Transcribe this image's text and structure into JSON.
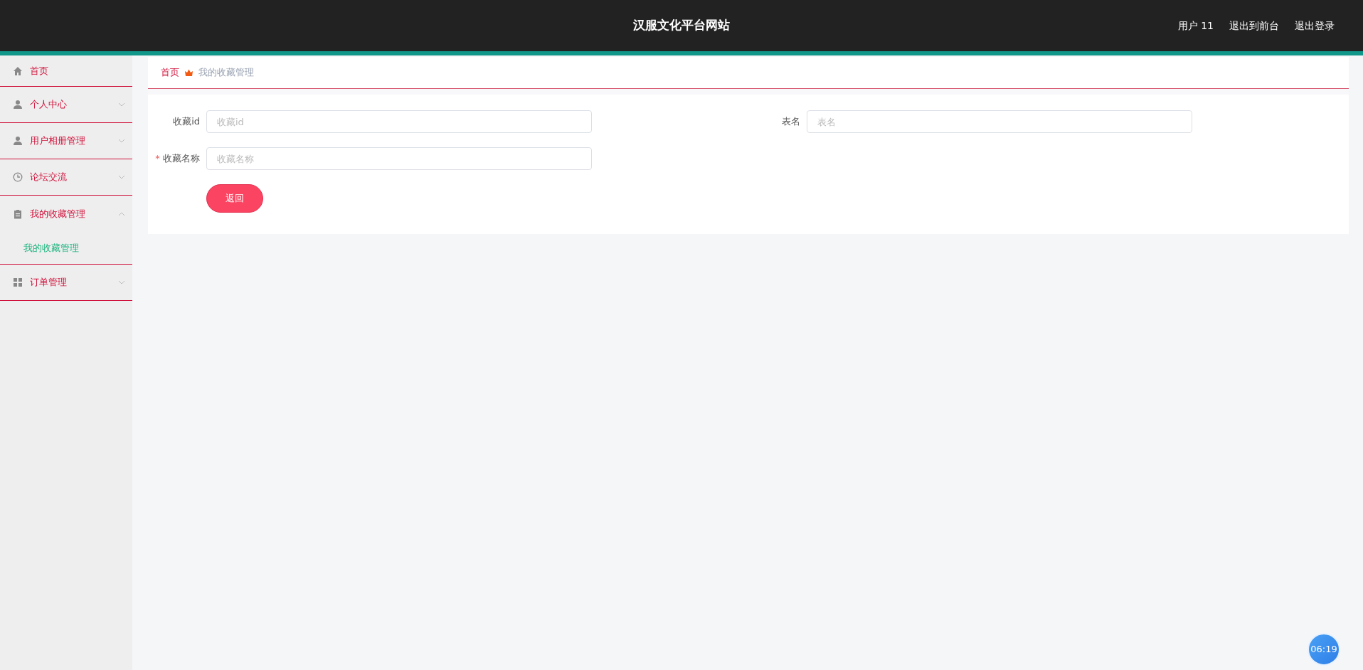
{
  "header": {
    "title": "汉服文化平台网站",
    "links": [
      "用户 11",
      "退出到前台",
      "退出登录"
    ]
  },
  "sidebar": {
    "items": [
      {
        "label": "首页",
        "kind": "link"
      },
      {
        "label": "个人中心",
        "kind": "menu",
        "expanded": false
      },
      {
        "label": "用户相册管理",
        "kind": "menu",
        "expanded": false
      },
      {
        "label": "论坛交流",
        "kind": "menu",
        "expanded": false
      },
      {
        "label": "我的收藏管理",
        "kind": "menu",
        "expanded": true,
        "children": [
          {
            "label": "我的收藏管理",
            "selected": true
          }
        ]
      },
      {
        "label": "订单管理",
        "kind": "menu",
        "expanded": false
      }
    ]
  },
  "breadcrumb": [
    "首页",
    "我的收藏管理"
  ],
  "form": {
    "fields": [
      {
        "label": "收藏id",
        "placeholder": "收藏id",
        "required": false
      },
      {
        "label": "表名",
        "placeholder": "表名",
        "required": false
      },
      {
        "label": "收藏名称",
        "placeholder": "收藏名称",
        "required": true,
        "required_mark": "*"
      }
    ],
    "buttons": [
      "返回"
    ]
  },
  "timer": "06:19"
}
